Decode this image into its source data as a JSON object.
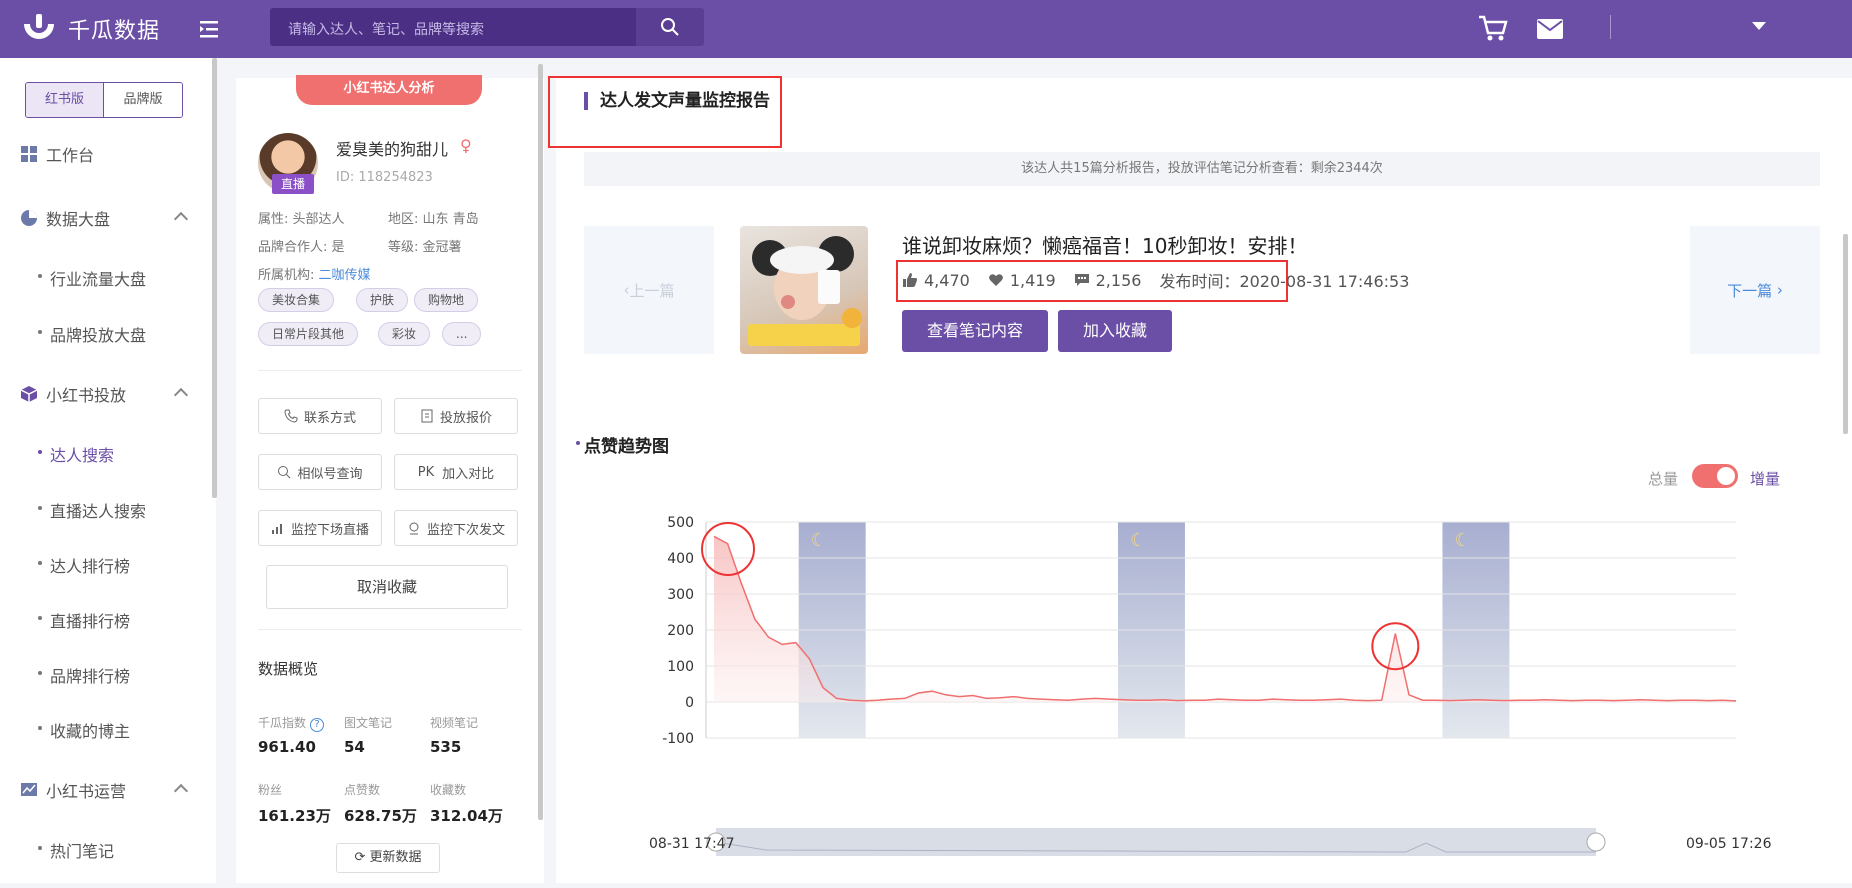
{
  "app": {
    "name": "千瓜数据"
  },
  "search": {
    "placeholder": "请输入达人、笔记、品牌等搜索"
  },
  "sidebar": {
    "version_tabs": [
      "红书版",
      "品牌版"
    ],
    "workbench": "工作台",
    "groups": [
      {
        "label": "数据大盘",
        "items": [
          "行业流量大盘",
          "品牌投放大盘"
        ]
      },
      {
        "label": "小红书投放",
        "items": [
          "达人搜索",
          "直播达人搜索",
          "达人排行榜",
          "直播排行榜",
          "品牌排行榜",
          "收藏的博主"
        ]
      },
      {
        "label": "小红书运营",
        "items": [
          "热门笔记"
        ]
      }
    ]
  },
  "profile": {
    "badge": "小红书达人分析",
    "name": "爱臭美的狗甜儿",
    "id_text": "ID: 118254823",
    "live_tag": "直播",
    "attr_type": "属性: 头部达人",
    "attr_region": "地区: 山东 青岛",
    "attr_brand": "品牌合作人: 是",
    "attr_level": "等级: 金冠薯",
    "agency_label": "所属机构:",
    "agency_name": "二咖传媒",
    "tags": [
      "美妆合集",
      "护肤",
      "购物地",
      "日常片段其他",
      "彩妆",
      "..."
    ],
    "buttons": [
      "联系方式",
      "投放报价",
      "相似号查询",
      "加入对比",
      "监控下场直播",
      "监控下次发文"
    ],
    "pk_prefix": "PK",
    "unfavorite": "取消收藏",
    "overview_title": "数据概览",
    "stats": [
      {
        "label": "千瓜指数",
        "value": "961.40"
      },
      {
        "label": "图文笔记",
        "value": "54"
      },
      {
        "label": "视频笔记",
        "value": "535"
      },
      {
        "label": "粉丝",
        "value": "161.23万"
      },
      {
        "label": "点赞数",
        "value": "628.75万"
      },
      {
        "label": "收藏数",
        "value": "312.04万"
      }
    ],
    "refresh": "更新数据"
  },
  "report": {
    "title": "达人发文声量监控报告",
    "info": "该达人共15篇分析报告，投放评估笔记分析查看：剩余2344次",
    "prev": "上一篇",
    "next": "下一篇",
    "note_title": "谁说卸妆麻烦？懒癌福音！10秒卸妆！安排！",
    "likes": "4,470",
    "favs": "1,419",
    "comments": "2,156",
    "publish_time": "发布时间：2020-08-31 17:46:53",
    "btn_view": "查看笔记内容",
    "btn_fav": "加入收藏",
    "chart_title": "点赞趋势图",
    "mode_total": "总量",
    "mode_increment": "增量",
    "range_start": "08-31 17:47",
    "range_end": "09-05 17:26"
  },
  "chart_data": {
    "type": "area",
    "title": "点赞趋势图",
    "ylim": [
      -100,
      500
    ],
    "y_ticks": [
      500,
      400,
      300,
      200,
      100,
      0,
      -100
    ],
    "x_range": [
      "08-31 17:47",
      "09-05 17:26"
    ],
    "series": [
      {
        "values": [
          460,
          440,
          330,
          230,
          180,
          160,
          165,
          120,
          40,
          10,
          5,
          3,
          5,
          8,
          10,
          25,
          30,
          20,
          15,
          18,
          10,
          12,
          15,
          10,
          8,
          6,
          5,
          8,
          10,
          8,
          6,
          5,
          5,
          6,
          4,
          5,
          5,
          8,
          6,
          5,
          5,
          8,
          6,
          5,
          5,
          6,
          8,
          5,
          4,
          5,
          190,
          20,
          5,
          5,
          4,
          5,
          6,
          5,
          4,
          5,
          5,
          6,
          5,
          4,
          5,
          5,
          4,
          5,
          6,
          5,
          4,
          5,
          5,
          4,
          5,
          3
        ]
      }
    ],
    "night_bands": [
      [
        0.09,
        0.155
      ],
      [
        0.4,
        0.465
      ],
      [
        0.715,
        0.78
      ]
    ],
    "colors": {
      "line": "#f06f6f",
      "fill": "#fbe1e1",
      "night": "#a7aed0"
    }
  }
}
